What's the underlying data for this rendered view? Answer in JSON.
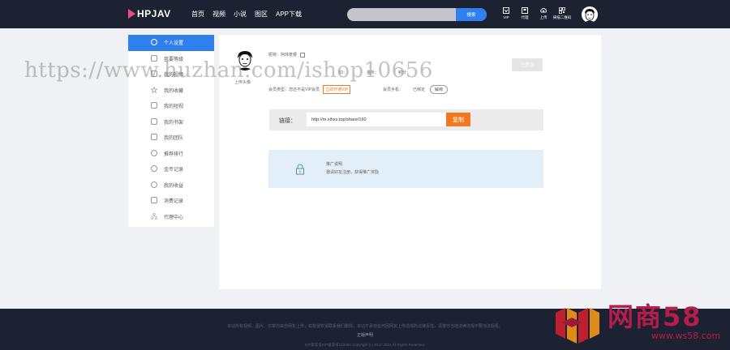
{
  "header": {
    "logo_text": "HPJAV",
    "nav": [
      "首页",
      "视频",
      "小说",
      "图区",
      "APP下载"
    ],
    "search": {
      "placeholder": "",
      "button_label": "搜索"
    },
    "icons": [
      {
        "name": "vip-icon",
        "label": "VIP"
      },
      {
        "name": "promote-icon",
        "label": "代理"
      },
      {
        "name": "upload-icon",
        "label": "上传"
      },
      {
        "name": "qrcode-icon",
        "label": "掃描二维码"
      }
    ]
  },
  "sidebar": {
    "items": [
      {
        "name": "sidebar-item-profile",
        "icon": "user-icon",
        "label": "个人设置",
        "active": true
      },
      {
        "name": "sidebar-item-2",
        "icon": "trophy-icon",
        "label": "我要等级"
      },
      {
        "name": "sidebar-item-3",
        "icon": "video-icon",
        "label": "我的视频"
      },
      {
        "name": "sidebar-item-4",
        "icon": "star-icon",
        "label": "我的收藏"
      },
      {
        "name": "sidebar-item-5",
        "icon": "clip-icon",
        "label": "我的短视"
      },
      {
        "name": "sidebar-item-6",
        "icon": "book-icon",
        "label": "我的书架"
      },
      {
        "name": "sidebar-item-7",
        "icon": "dots-icon",
        "label": "我的团队"
      },
      {
        "name": "sidebar-item-8",
        "icon": "award-icon",
        "label": "推荐排行"
      },
      {
        "name": "sidebar-item-9",
        "icon": "coin-icon",
        "label": "金币记录"
      },
      {
        "name": "sidebar-item-10",
        "icon": "money-icon",
        "label": "我的收益"
      },
      {
        "name": "sidebar-item-11",
        "icon": "receipt-icon",
        "label": "消费记录"
      },
      {
        "name": "sidebar-item-12",
        "icon": "network-icon",
        "label": "代理中心"
      }
    ]
  },
  "profile": {
    "upload_avatar": "上传头像",
    "nickname": "昵称：阿炜麦梗",
    "mid_fields": [
      "ID：",
      "金币：",
      "积分："
    ],
    "vip_type": "会员类型：您还不是VIP会员",
    "vip_button": "立即开通VIP",
    "phone_label": "会员手机：",
    "phone_status": "已绑定",
    "unbind_button": "解绑",
    "sign_button": "已签到"
  },
  "share": {
    "label": "链接：",
    "url": "http://m.xihxx.top/share/160",
    "copy_button": "复制"
  },
  "promo": {
    "line1": "推广说明",
    "line2": "邀请好友注册，获得推广奖励"
  },
  "footer": {
    "disclaimer": "本站所有视频、图片、文章均来自网友上传，如有侵权请联系我们删除，本站不承担任何因网友上传造成的法律责任，请遵守当地法律法规不要违法观看。",
    "link": "正版声明",
    "copyright": "ICP备案号ICP备案号123456   Copyright (c) 2017-2021 All Rights Reserved."
  },
  "watermark": {
    "text": "https://www.huzhan.com/ishop10656",
    "brand_name": "网商58",
    "brand_url": "www.ws58.com"
  },
  "colors": {
    "header_bg": "#1c2232",
    "accent": "#2f80ed",
    "orange": "#f0781e",
    "brand": "#b51d4a"
  }
}
